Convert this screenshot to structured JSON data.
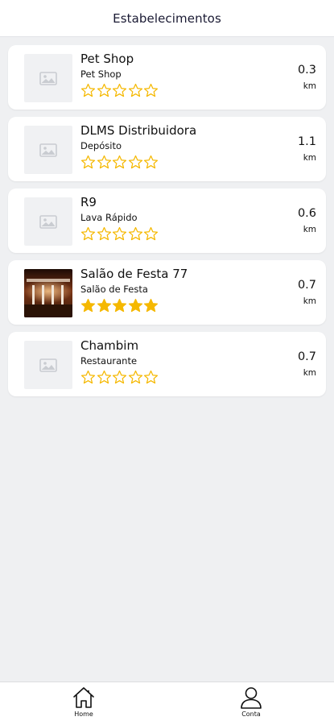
{
  "header": {
    "title": "Estabelecimentos"
  },
  "colors": {
    "star": "#f5b800",
    "placeholder_icon": "#c9ccd1"
  },
  "establishments": [
    {
      "name": "Pet Shop",
      "category": "Pet Shop",
      "rating": 0,
      "distance": "0.3",
      "unit": "km",
      "image": "placeholder-icon"
    },
    {
      "name": "DLMS Distribuidora",
      "category": "Depósito",
      "rating": 0,
      "distance": "1.1",
      "unit": "km",
      "image": "placeholder-icon"
    },
    {
      "name": "R9",
      "category": "Lava Rápido",
      "rating": 0,
      "distance": "0.6",
      "unit": "km",
      "image": "placeholder-icon"
    },
    {
      "name": "Salão de Festa 77",
      "category": "Salão de Festa",
      "rating": 5,
      "distance": "0.7",
      "unit": "km",
      "image": "photo"
    },
    {
      "name": "Chambim",
      "category": "Restaurante",
      "rating": 0,
      "distance": "0.7",
      "unit": "km",
      "image": "placeholder-icon"
    }
  ],
  "nav": {
    "home_label": "Home",
    "account_label": "Conta"
  }
}
